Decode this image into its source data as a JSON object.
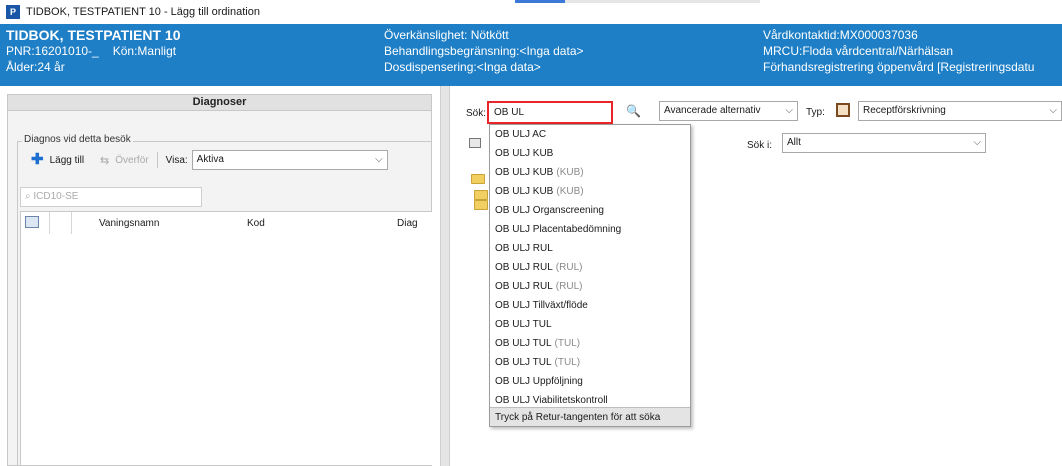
{
  "titlebar": {
    "title": "TIDBOK, TESTPATIENT 10 - Lägg till ordination",
    "app_icon": "P"
  },
  "header": {
    "col1": {
      "name": "TIDBOK, TESTPATIENT 10",
      "pnr": "PNR:16201010-_",
      "gender": "Kön:Manligt",
      "age": "Ålder:24 år"
    },
    "col2": {
      "allergy": "Överkänslighet: Nötkött",
      "treatment": "Behandlingsbegränsning:<Inga data>",
      "dosage": "Dosdispensering:<Inga data>"
    },
    "col3": {
      "contact": "Vårdkontaktid:MX000037036",
      "mrcu": "MRCU:Floda vårdcentral/Närhälsan",
      "prereg": "Förhandsregistrering öppenvård [Registreringsdatu"
    },
    "bg_color": "#1e7fc6"
  },
  "left": {
    "panel_title": "Diagnoser",
    "group_legend": "Diagnos vid detta besök",
    "add_label": "Lägg till",
    "transfer_label": "Överför",
    "visa_label": "Visa:",
    "visa_value": "Aktiva",
    "icd_placeholder": "ICD10-SE",
    "columns": [
      "Vaningsnamn",
      "Kod",
      "Diag"
    ]
  },
  "right": {
    "search_label": "Sök:",
    "search_value": "OB UL",
    "advanced_value": "Avancerade alternativ",
    "type_label": "Typ:",
    "type_value": "Receptförskrivning",
    "search_in_label": "Sök i:",
    "search_in_value": "Allt"
  },
  "dropdown": {
    "items": [
      {
        "text": "OB ULJ AC",
        "suffix": ""
      },
      {
        "text": "OB ULJ KUB",
        "suffix": ""
      },
      {
        "text": "OB ULJ KUB",
        "suffix": "(KUB)"
      },
      {
        "text": "OB ULJ KUB",
        "suffix": "(KUB)"
      },
      {
        "text": "OB ULJ Organscreening",
        "suffix": ""
      },
      {
        "text": "OB ULJ Placentabedömning",
        "suffix": ""
      },
      {
        "text": "OB ULJ RUL",
        "suffix": ""
      },
      {
        "text": "OB ULJ RUL",
        "suffix": "(RUL)"
      },
      {
        "text": "OB ULJ RUL",
        "suffix": "(RUL)"
      },
      {
        "text": "OB ULJ Tillväxt/flöde",
        "suffix": ""
      },
      {
        "text": "OB ULJ TUL",
        "suffix": ""
      },
      {
        "text": "OB ULJ TUL",
        "suffix": "(TUL)"
      },
      {
        "text": "OB ULJ TUL",
        "suffix": "(TUL)"
      },
      {
        "text": "OB ULJ Uppföljning",
        "suffix": ""
      },
      {
        "text": "OB ULJ Viabilitetskontroll",
        "suffix": ""
      }
    ],
    "footer": "Tryck på Retur-tangenten för att söka"
  },
  "colors": {
    "highlight_border": "#e8262a",
    "accent": "#1e7fc6"
  }
}
